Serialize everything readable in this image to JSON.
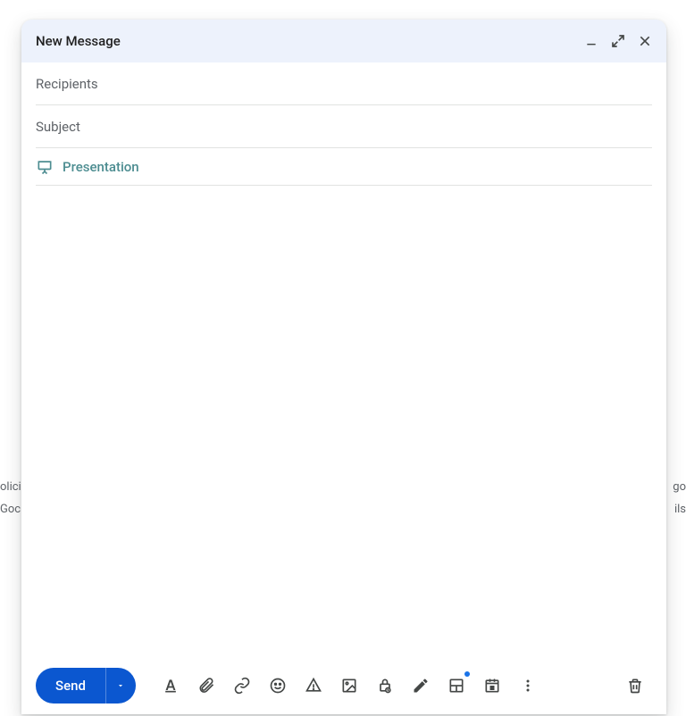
{
  "header": {
    "title": "New Message"
  },
  "fields": {
    "recipients_placeholder": "Recipients",
    "recipients_value": "",
    "subject_placeholder": "Subject",
    "subject_value": ""
  },
  "body": {
    "chip_label": "Presentation"
  },
  "toolbar": {
    "send_label": "Send"
  },
  "background": {
    "left_line1": "olicie",
    "left_line2": "Goc",
    "right_line1": "go",
    "right_line2": "ils"
  }
}
